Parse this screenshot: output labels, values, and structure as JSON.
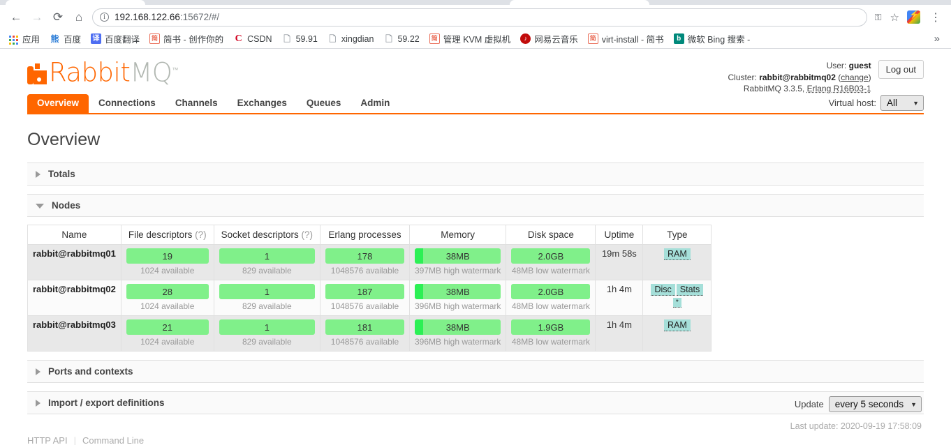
{
  "browser": {
    "back_icon": "←",
    "forward_icon": "→",
    "reload_icon": "⟳",
    "home_icon": "⌂",
    "url_main": "192.168.122.66",
    "url_rest": ":15672/#/",
    "key_icon": "key-icon",
    "star_icon": "☆",
    "kebab_icon": "⋮",
    "bookmarks": [
      {
        "label": "应用",
        "fav": "apps"
      },
      {
        "label": "百度",
        "fav": "baidu",
        "glyph": "熊"
      },
      {
        "label": "百度翻译",
        "fav": "fanyi",
        "glyph": "译"
      },
      {
        "label": "简书 - 创作你的",
        "fav": "jianshu",
        "glyph": "简"
      },
      {
        "label": "CSDN",
        "fav": "csdn",
        "glyph": "C"
      },
      {
        "label": "59.91",
        "fav": "doc",
        "glyph": "🗋"
      },
      {
        "label": "xingdian",
        "fav": "doc",
        "glyph": "🗋"
      },
      {
        "label": "59.22",
        "fav": "doc",
        "glyph": "🗋"
      },
      {
        "label": "管理 KVM 虚拟机",
        "fav": "jianshu",
        "glyph": "简"
      },
      {
        "label": "网易云音乐",
        "fav": "netease",
        "glyph": "♪"
      },
      {
        "label": "virt-install - 简书",
        "fav": "jianshu",
        "glyph": "简"
      },
      {
        "label": "微软 Bing 搜索 -",
        "fav": "bing",
        "glyph": "b"
      }
    ],
    "more_icon": "»"
  },
  "header": {
    "logo_rabbit": "Rabbit",
    "logo_mq": "MQ",
    "logo_tm": "™",
    "user_label": "User:",
    "user_name": "guest",
    "cluster_label": "Cluster:",
    "cluster_name": "rabbit@rabbitmq02",
    "cluster_change": "change",
    "version_line_prefix": "RabbitMQ 3.3.5,",
    "erlang_version": "Erlang R16B03-1",
    "logout_label": "Log out"
  },
  "nav": {
    "tabs": [
      {
        "label": "Overview",
        "active": true
      },
      {
        "label": "Connections",
        "active": false
      },
      {
        "label": "Channels",
        "active": false
      },
      {
        "label": "Exchanges",
        "active": false
      },
      {
        "label": "Queues",
        "active": false
      },
      {
        "label": "Admin",
        "active": false
      }
    ],
    "vhost_label": "Virtual host:",
    "vhost_value": "All",
    "caret": "▼"
  },
  "main": {
    "page_title": "Overview",
    "sections": [
      {
        "label": "Totals",
        "open": false
      },
      {
        "label": "Nodes",
        "open": true
      },
      {
        "label": "Ports and contexts",
        "open": false
      },
      {
        "label": "Import / export definitions",
        "open": false
      }
    ],
    "table": {
      "headers": [
        {
          "text": "Name",
          "hint": ""
        },
        {
          "text": "File descriptors",
          "hint": "(?)"
        },
        {
          "text": "Socket descriptors",
          "hint": "(?)"
        },
        {
          "text": "Erlang processes",
          "hint": ""
        },
        {
          "text": "Memory",
          "hint": ""
        },
        {
          "text": "Disk space",
          "hint": ""
        },
        {
          "text": "Uptime",
          "hint": ""
        },
        {
          "text": "Type",
          "hint": ""
        }
      ],
      "rows": [
        {
          "name": "rabbit@rabbitmq01",
          "file_descriptors": {
            "value": "19",
            "sub": "1024 available",
            "pct": 100,
            "fill": 0
          },
          "socket_descriptors": {
            "value": "1",
            "sub": "829 available",
            "pct": 100,
            "fill": 0
          },
          "erlang_processes": {
            "value": "178",
            "sub": "1048576 available",
            "pct": 100,
            "fill": 0
          },
          "memory": {
            "value": "38MB",
            "sub": "397MB high watermark",
            "pct": 100,
            "fill": 10
          },
          "disk_space": {
            "value": "2.0GB",
            "sub": "48MB low watermark",
            "pct": 100,
            "fill": 0
          },
          "uptime": "19m 58s",
          "type": [
            {
              "label": "RAM",
              "small": false
            }
          ]
        },
        {
          "name": "rabbit@rabbitmq02",
          "file_descriptors": {
            "value": "28",
            "sub": "1024 available",
            "pct": 100,
            "fill": 0
          },
          "socket_descriptors": {
            "value": "1",
            "sub": "829 available",
            "pct": 100,
            "fill": 0
          },
          "erlang_processes": {
            "value": "187",
            "sub": "1048576 available",
            "pct": 100,
            "fill": 0
          },
          "memory": {
            "value": "38MB",
            "sub": "396MB high watermark",
            "pct": 100,
            "fill": 10
          },
          "disk_space": {
            "value": "2.0GB",
            "sub": "48MB low watermark",
            "pct": 100,
            "fill": 0
          },
          "uptime": "1h 4m",
          "type": [
            {
              "label": "Disc",
              "small": false
            },
            {
              "label": "Stats",
              "small": false
            },
            {
              "label": "*",
              "small": true
            }
          ]
        },
        {
          "name": "rabbit@rabbitmq03",
          "file_descriptors": {
            "value": "21",
            "sub": "1024 available",
            "pct": 100,
            "fill": 0
          },
          "socket_descriptors": {
            "value": "1",
            "sub": "829 available",
            "pct": 100,
            "fill": 0
          },
          "erlang_processes": {
            "value": "181",
            "sub": "1048576 available",
            "pct": 100,
            "fill": 0
          },
          "memory": {
            "value": "38MB",
            "sub": "396MB high watermark",
            "pct": 100,
            "fill": 10
          },
          "disk_space": {
            "value": "1.9GB",
            "sub": "48MB low watermark",
            "pct": 100,
            "fill": 0
          },
          "uptime": "1h 4m",
          "type": [
            {
              "label": "RAM",
              "small": false
            }
          ]
        }
      ]
    }
  },
  "footer": {
    "http_api": "HTTP API",
    "separator": "|",
    "command_line": "Command Line",
    "update_label": "Update",
    "update_value": "every 5 seconds",
    "caret": "▼",
    "last_update": "Last update: 2020-09-19 17:58:09"
  },
  "colors": {
    "accent": "#ff6600",
    "bar_bg": "#80f08a",
    "bar_fill": "#2cf055",
    "badge_bg": "#a5dfd9"
  }
}
